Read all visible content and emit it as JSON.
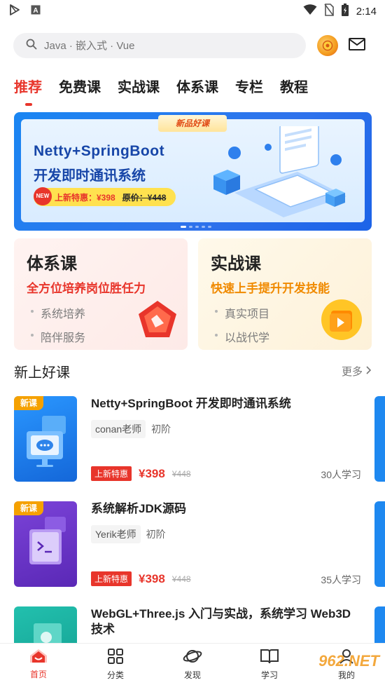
{
  "status_bar": {
    "time": "2:14"
  },
  "search": {
    "placeholder": "Java · 嵌入式 · Vue"
  },
  "tabs": [
    {
      "label": "推荐",
      "active": true
    },
    {
      "label": "免费课"
    },
    {
      "label": "实战课"
    },
    {
      "label": "体系课"
    },
    {
      "label": "专栏"
    },
    {
      "label": "教程"
    }
  ],
  "banner": {
    "ribbon": "新品好课",
    "title": "Netty+SpringBoot",
    "subtitle": "开发即时通讯系统",
    "badge": "NEW",
    "special_price": "上新特惠：¥398",
    "original_price": "原价：¥448"
  },
  "categories": [
    {
      "title": "体系课",
      "desc": "全方位培养岗位胜任力",
      "points": [
        "系统培养",
        "陪伴服务"
      ],
      "icon": "pentagon-badge-icon"
    },
    {
      "title": "实战课",
      "desc": "快速上手提升开发技能",
      "points": [
        "真实项目",
        "以战代学"
      ],
      "icon": "play-folder-icon"
    }
  ],
  "section": {
    "title": "新上好课",
    "more": "更多"
  },
  "courses": [
    {
      "tag": "新课",
      "title": "Netty+SpringBoot 开发即时通讯系统",
      "teacher": "conan老师",
      "level": "初阶",
      "badge": "上新特惠",
      "price": "¥398",
      "original_price": "¥448",
      "students": "30人学习",
      "color": "#1e88f0"
    },
    {
      "tag": "新课",
      "title": "系统解析JDK源码",
      "teacher": "Yerik老师",
      "level": "初阶",
      "badge": "上新特惠",
      "price": "¥398",
      "original_price": "¥448",
      "students": "35人学习",
      "color": "#6a35c8"
    },
    {
      "tag": "",
      "title": "WebGL+Three.js 入门与实战，系统学习 Web3D 技术",
      "color": "#12a89a"
    }
  ],
  "bottom_nav": [
    {
      "label": "首页",
      "icon": "home-icon",
      "active": true
    },
    {
      "label": "分类",
      "icon": "grid-icon"
    },
    {
      "label": "发现",
      "icon": "planet-icon"
    },
    {
      "label": "学习",
      "icon": "book-icon"
    },
    {
      "label": "我的",
      "icon": "profile-icon"
    }
  ],
  "watermark": "962.NET",
  "colors": {
    "accent": "#e8352b",
    "orange": "#f08a00",
    "blue": "#1e88f0"
  }
}
